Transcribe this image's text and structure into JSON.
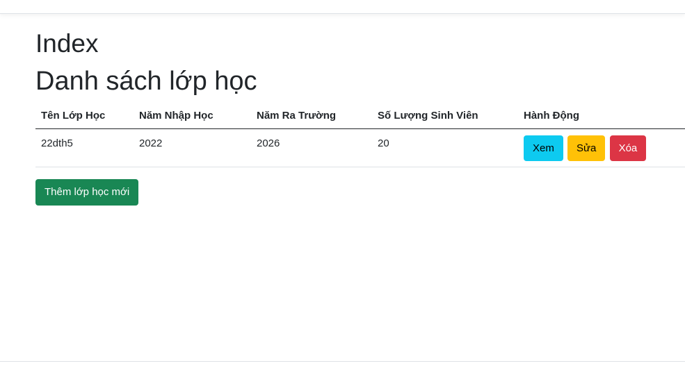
{
  "page": {
    "title": "Index",
    "heading": "Danh sách lớp học"
  },
  "table": {
    "headers": [
      "Tên Lớp Học",
      "Năm Nhập Học",
      "Năm Ra Trường",
      "Số Lượng Sinh Viên",
      "Hành Động"
    ],
    "rows": [
      {
        "name": "22dth5",
        "year_in": "2022",
        "year_out": "2026",
        "count": "20"
      }
    ],
    "actions": {
      "view_label": "Xem",
      "edit_label": "Sửa",
      "delete_label": "Xóa"
    }
  },
  "add_button_label": "Thêm lớp học mới",
  "colors": {
    "view": "#0dcaf0",
    "edit": "#ffc107",
    "delete": "#dc3545",
    "add": "#198754"
  }
}
